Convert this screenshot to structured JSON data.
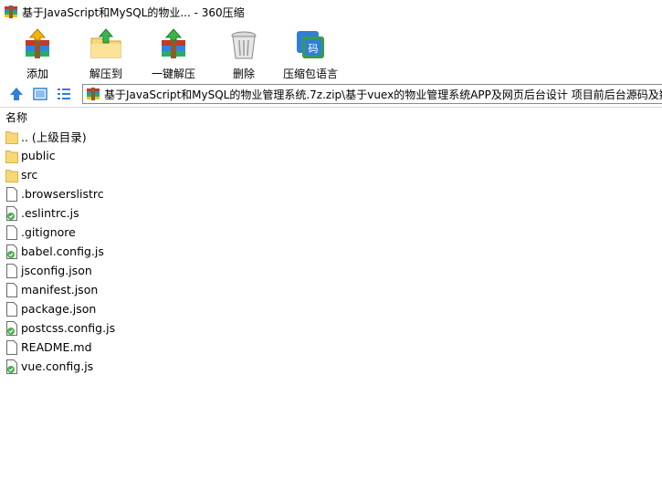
{
  "window": {
    "title": "基于JavaScript和MySQL的物业... - 360压缩"
  },
  "toolbar": {
    "add": "添加",
    "extract_to": "解压到",
    "one_click_extract": "一键解压",
    "delete": "删除",
    "language": "压缩包语言"
  },
  "addressbar": {
    "path": "基于JavaScript和MySQL的物业管理系统.7z.zip\\基于vuex的物业管理系统APP及网页后台设计 项目前后台源码及数"
  },
  "list": {
    "header_name": "名称",
    "items": [
      {
        "name": ".. (上级目录)",
        "icon": "folder-icon"
      },
      {
        "name": "public",
        "icon": "folder-icon"
      },
      {
        "name": "src",
        "icon": "folder-icon"
      },
      {
        "name": ".browserslistrc",
        "icon": "file-icon"
      },
      {
        "name": ".eslintrc.js",
        "icon": "js-file-icon"
      },
      {
        "name": ".gitignore",
        "icon": "file-icon"
      },
      {
        "name": "babel.config.js",
        "icon": "js-file-icon"
      },
      {
        "name": "jsconfig.json",
        "icon": "file-icon"
      },
      {
        "name": "manifest.json",
        "icon": "file-icon"
      },
      {
        "name": "package.json",
        "icon": "file-icon"
      },
      {
        "name": "postcss.config.js",
        "icon": "js-file-icon"
      },
      {
        "name": "README.md",
        "icon": "file-icon"
      },
      {
        "name": "vue.config.js",
        "icon": "js-file-icon"
      }
    ]
  },
  "colors": {
    "folder": "#f8d775",
    "js_badge": "#4caf50",
    "nav_blue": "#2f7fd8"
  }
}
